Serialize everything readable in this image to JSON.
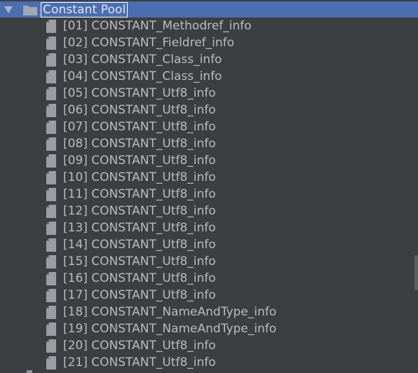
{
  "tree": {
    "root": {
      "label": "Constant Pool",
      "expanded": true,
      "icon": "folder-icon"
    },
    "children": [
      {
        "label": "[01] CONSTANT_Methodref_info",
        "icon": "file-icon"
      },
      {
        "label": "[02] CONSTANT_Fieldref_info",
        "icon": "file-icon"
      },
      {
        "label": "[03] CONSTANT_Class_info",
        "icon": "file-icon"
      },
      {
        "label": "[04] CONSTANT_Class_info",
        "icon": "file-icon"
      },
      {
        "label": "[05] CONSTANT_Utf8_info",
        "icon": "file-icon"
      },
      {
        "label": "[06] CONSTANT_Utf8_info",
        "icon": "file-icon"
      },
      {
        "label": "[07] CONSTANT_Utf8_info",
        "icon": "file-icon"
      },
      {
        "label": "[08] CONSTANT_Utf8_info",
        "icon": "file-icon"
      },
      {
        "label": "[09] CONSTANT_Utf8_info",
        "icon": "file-icon"
      },
      {
        "label": "[10] CONSTANT_Utf8_info",
        "icon": "file-icon"
      },
      {
        "label": "[11] CONSTANT_Utf8_info",
        "icon": "file-icon"
      },
      {
        "label": "[12] CONSTANT_Utf8_info",
        "icon": "file-icon"
      },
      {
        "label": "[13] CONSTANT_Utf8_info",
        "icon": "file-icon"
      },
      {
        "label": "[14] CONSTANT_Utf8_info",
        "icon": "file-icon"
      },
      {
        "label": "[15] CONSTANT_Utf8_info",
        "icon": "file-icon"
      },
      {
        "label": "[16] CONSTANT_Utf8_info",
        "icon": "file-icon"
      },
      {
        "label": "[17] CONSTANT_Utf8_info",
        "icon": "file-icon"
      },
      {
        "label": "[18] CONSTANT_NameAndType_info",
        "icon": "file-icon"
      },
      {
        "label": "[19] CONSTANT_NameAndType_info",
        "icon": "file-icon"
      },
      {
        "label": "[20] CONSTANT_Utf8_info",
        "icon": "file-icon"
      },
      {
        "label": "[21] CONSTANT_Utf8_info",
        "icon": "file-icon"
      }
    ]
  },
  "colors": {
    "background": "#3c3f41",
    "selection": "#4b6eaf",
    "text": "#b8bcc0",
    "icon": "#9a9ea3"
  }
}
